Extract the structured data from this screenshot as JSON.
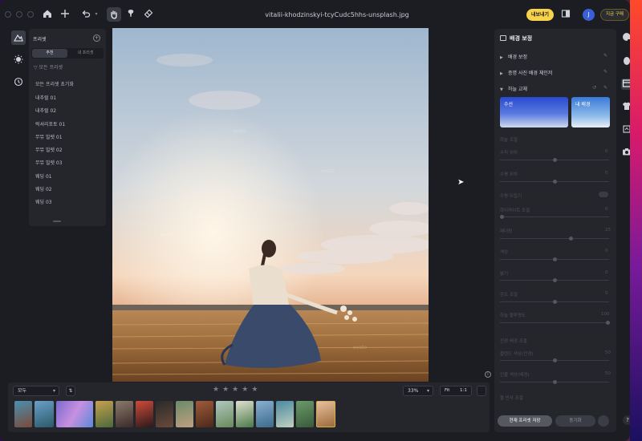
{
  "titlebar": {
    "file_name": "vitalii-khodzinskyi-tcyCudc5hhs-unsplash.jpg",
    "export_label": "내보내기",
    "avatar_initial": "J",
    "buy_label": "지금 구매"
  },
  "preset_panel": {
    "title": "프리셋",
    "tabs": [
      "추천",
      "내 프리셋"
    ],
    "filter_label": "모든 프리셋",
    "items": [
      "모든 프리셋 초기화",
      "내추럴 01",
      "내추럴 02",
      "럭셔리포토 01",
      "무뮤 빌렛 01",
      "무뮤 빌렛 02",
      "무뮤 빌렛 03",
      "웨딩 01",
      "웨딩 02",
      "웨딩 03"
    ]
  },
  "bottom_bar": {
    "filter_value": "모두",
    "zoom_value": "33%",
    "fit_label": "Fit",
    "one_to_one_label": "1:1",
    "star_count": 5
  },
  "right_panel": {
    "title": "배경 보정",
    "sections": [
      "배경 보정",
      "증명 사진 배경 체인저",
      "하늘 교체"
    ],
    "sky_cards": [
      "수선",
      "내 배경"
    ],
    "sky_adjust_title": "하늘 조절",
    "sliders": [
      {
        "label": "수직 위치",
        "value": "0"
      },
      {
        "label": "수평 위치",
        "value": "0"
      },
      {
        "label": "수평 뒤집기",
        "value": ""
      },
      {
        "label": "하이라이트 조절",
        "value": "0"
      },
      {
        "label": "페더링",
        "value": "25"
      },
      {
        "label": "색상",
        "value": "0"
      },
      {
        "label": "밝기",
        "value": "0"
      },
      {
        "label": "온도 조절",
        "value": "0"
      },
      {
        "label": "하늘 불투명도",
        "value": "100"
      }
    ],
    "bg_adjust_title": "전경 배경 조절",
    "bg_sliders": [
      {
        "label": "블렌드 색상(전경)",
        "value": "50"
      },
      {
        "label": "인물 색상(배경)",
        "value": "50"
      }
    ],
    "bottom_row_label": "물 반사 조절",
    "save_label": "현재 프리셋 저장",
    "sync_label": "동기화"
  }
}
